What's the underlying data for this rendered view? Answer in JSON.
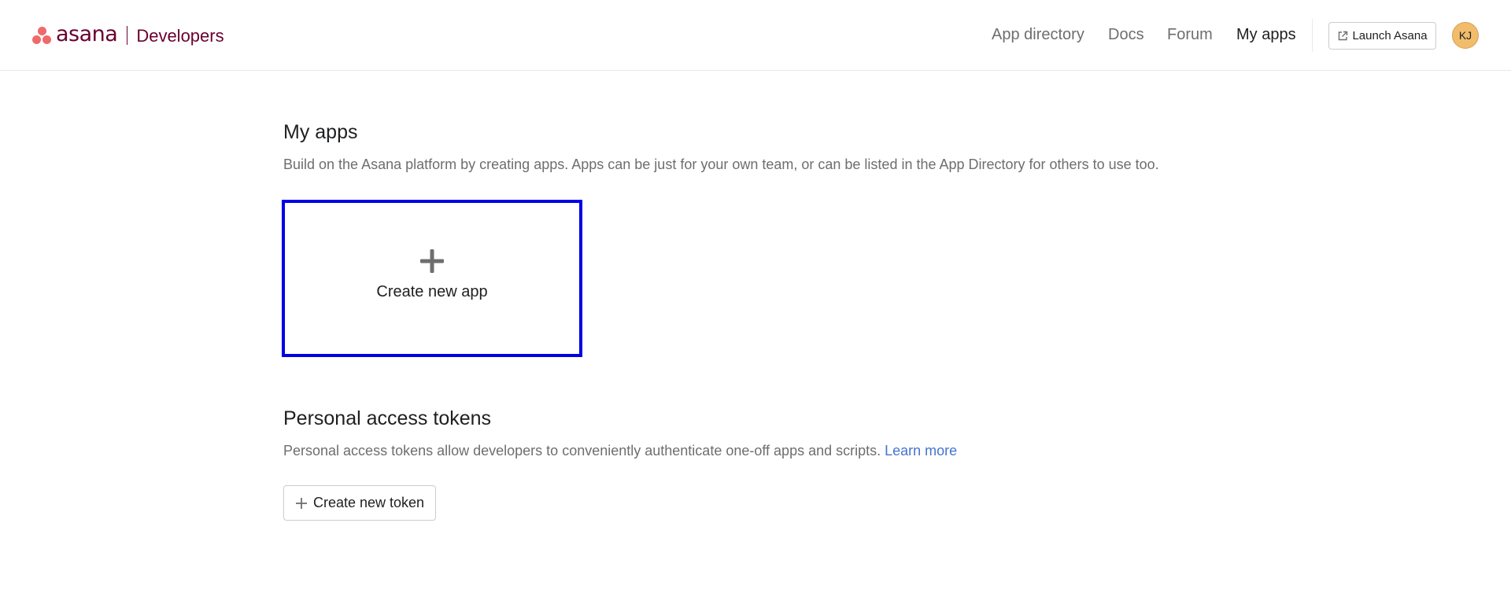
{
  "header": {
    "logo_word": "asana",
    "logo_sub": "Developers",
    "nav": [
      {
        "label": "App directory",
        "active": false
      },
      {
        "label": "Docs",
        "active": false
      },
      {
        "label": "Forum",
        "active": false
      },
      {
        "label": "My apps",
        "active": true
      }
    ],
    "launch_label": "Launch Asana",
    "avatar_initials": "KJ",
    "icons": {
      "launch": "external-link-icon",
      "logo": "asana-dots-icon"
    }
  },
  "my_apps": {
    "title": "My apps",
    "description": "Build on the Asana platform by creating apps. Apps can be just for your own team, or can be listed in the App Directory for others to use too.",
    "create_card_label": "Create new app",
    "create_card_icon": "plus-icon"
  },
  "tokens": {
    "title": "Personal access tokens",
    "description": "Personal access tokens allow developers to conveniently authenticate one-off apps and scripts.",
    "learn_more": "Learn more",
    "create_button_label": "Create new token",
    "create_button_icon": "plus-icon"
  },
  "colors": {
    "brand_coral": "#f06a6a",
    "brand_plum": "#690031",
    "link_blue": "#4573d2",
    "focus_border": "#0000e6",
    "avatar_bg": "#f1bd6c"
  }
}
